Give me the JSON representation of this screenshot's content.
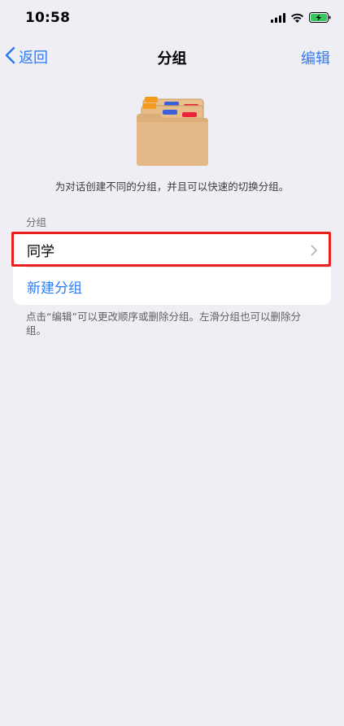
{
  "status_bar": {
    "time": "10:58",
    "icons": [
      "signal-icon",
      "wifi-icon",
      "battery-charging-icon"
    ]
  },
  "nav": {
    "back_label": "返回",
    "title": "分组",
    "edit_label": "编辑"
  },
  "hint": "为对话创建不同的分组，并且可以快速的切换分组。",
  "section": {
    "header": "分组",
    "groups": [
      {
        "label": "同学"
      }
    ],
    "new_group_label": "新建分组"
  },
  "footer_note": "点击“编辑”可以更改顺序或删除分组。左滑分组也可以删除分组。",
  "colors": {
    "accent": "#2f7cf6",
    "background": "#efeef4",
    "highlight": "#e82020"
  }
}
